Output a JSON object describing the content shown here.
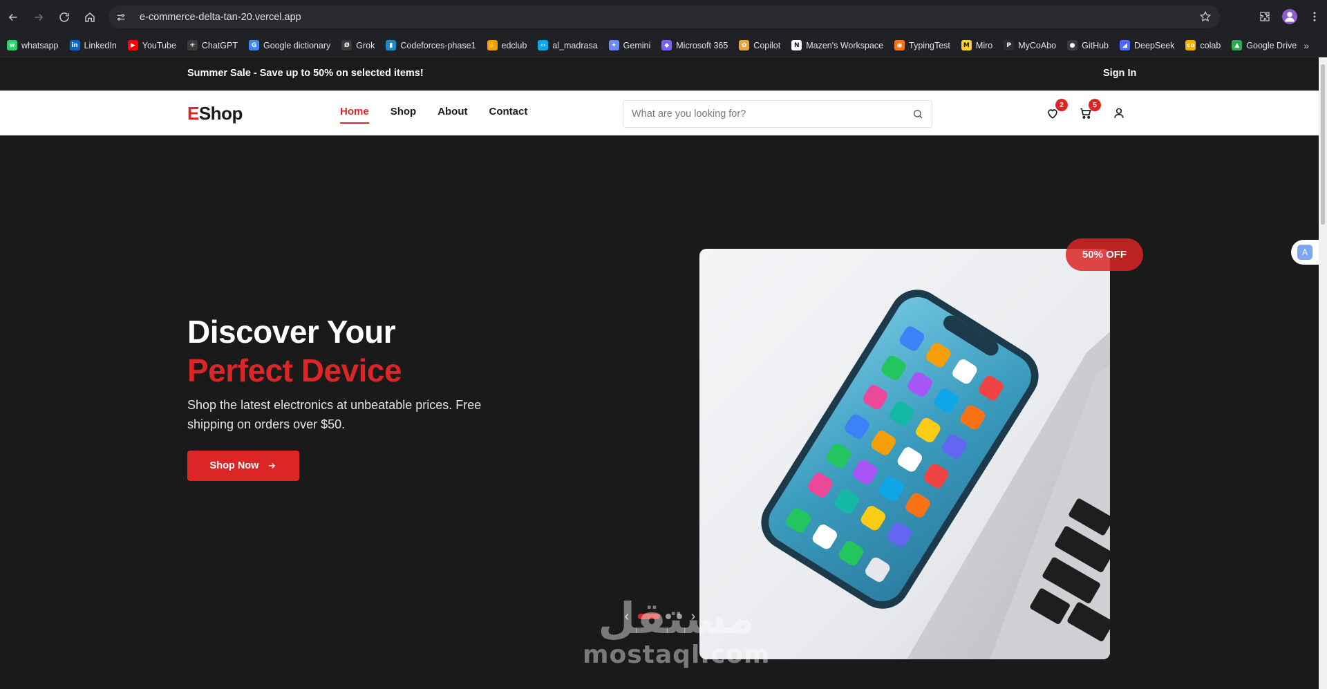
{
  "browser": {
    "url": "e-commerce-delta-tan-20.vercel.app",
    "bookmarks": [
      {
        "label": "whatsapp",
        "color": "#25d366",
        "glyph": "w"
      },
      {
        "label": "LinkedIn",
        "color": "#0a66c2",
        "glyph": "in"
      },
      {
        "label": "YouTube",
        "color": "#ff0000",
        "glyph": "▶"
      },
      {
        "label": "ChatGPT",
        "color": "#3c3c3c",
        "glyph": "✳"
      },
      {
        "label": "Google dictionary",
        "color": "#4285f4",
        "glyph": "G"
      },
      {
        "label": "Grok",
        "color": "#3c3c3c",
        "glyph": "Ø"
      },
      {
        "label": "Codeforces-phase1",
        "color": "#1f8acb",
        "glyph": "▮"
      },
      {
        "label": "edclub",
        "color": "#f59e0b",
        "glyph": "✋"
      },
      {
        "label": "al_madrasa",
        "color": "#0ea5e9",
        "glyph": "‹›"
      },
      {
        "label": "Gemini",
        "color": "#6b8afd",
        "glyph": "✦"
      },
      {
        "label": "Microsoft 365",
        "color": "#7b61ff",
        "glyph": "◆"
      },
      {
        "label": "Copilot",
        "color": "#e8a33d",
        "glyph": "✿"
      },
      {
        "label": "Mazen's Workspace",
        "color": "#ffffff",
        "glyph": "N"
      },
      {
        "label": "TypingTest",
        "color": "#f97316",
        "glyph": "◉"
      },
      {
        "label": "Miro",
        "color": "#ffd02f",
        "glyph": "M"
      },
      {
        "label": "MyCoAbo",
        "color": "#2d2d2d",
        "glyph": "P"
      },
      {
        "label": "GitHub",
        "color": "#3c3c3c",
        "glyph": "●"
      },
      {
        "label": "DeepSeek",
        "color": "#4d6bfe",
        "glyph": "◢"
      },
      {
        "label": "colab",
        "color": "#f9ab00",
        "glyph": "co"
      },
      {
        "label": "Google Drive",
        "color": "#34a853",
        "glyph": "▲"
      }
    ]
  },
  "announcement": {
    "text": "Summer Sale - Save up to 50% on selected items!",
    "sign_in": "Sign In"
  },
  "header": {
    "logo_accent": "E",
    "logo_rest": "Shop",
    "nav": [
      "Home",
      "Shop",
      "About",
      "Contact"
    ],
    "active_nav": "Home",
    "search_placeholder": "What are you looking for?",
    "wishlist_count": "2",
    "cart_count": "5"
  },
  "hero": {
    "title_line1": "Discover Your",
    "title_line2": "Perfect Device",
    "subtitle": "Shop the latest electronics at unbeatable prices. Free shipping on orders over $50.",
    "cta": "Shop Now",
    "discount": "50% OFF",
    "slide_count": 3,
    "active_slide": 0
  },
  "watermark": {
    "arabic": "مستقل",
    "latin": "mostaql.com"
  },
  "colors": {
    "accent": "#dc2626",
    "dark": "#1a1a1a"
  }
}
